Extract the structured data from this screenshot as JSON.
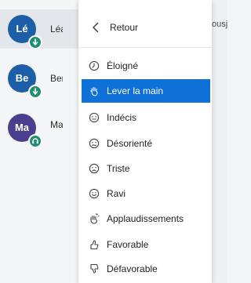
{
  "participants": [
    {
      "initials": "Lé",
      "name": "Léa",
      "avatar_color": "#1d5ea8",
      "status_color": "#1f8f73",
      "status_icon": "arrow-down-icon",
      "active": true
    },
    {
      "initials": "Be",
      "name": "Benj",
      "avatar_color": "#1d5ea8",
      "status_color": "#1f8f73",
      "status_icon": "arrow-down-icon",
      "active": false
    },
    {
      "initials": "Ma",
      "name": "Mari",
      "avatar_color": "#4a3f8f",
      "status_color": "#1f8f73",
      "status_icon": "headset-icon",
      "active": false
    }
  ],
  "background_header_fragment": "ousj",
  "menu": {
    "back_label": "Retour",
    "selected_color": "#0f70d7",
    "items": [
      {
        "label": "Éloigné",
        "icon": "clock-icon",
        "selected": false
      },
      {
        "label": "Lever la main",
        "icon": "raised-hand-icon",
        "selected": true
      },
      {
        "label": "Indécis",
        "icon": "neutral-face-icon",
        "selected": false
      },
      {
        "label": "Désorienté",
        "icon": "confused-face-icon",
        "selected": false
      },
      {
        "label": "Triste",
        "icon": "sad-face-icon",
        "selected": false
      },
      {
        "label": "Ravi",
        "icon": "happy-face-icon",
        "selected": false
      },
      {
        "label": "Applaudissements",
        "icon": "clapping-hands-icon",
        "selected": false
      },
      {
        "label": "Favorable",
        "icon": "thumbs-up-icon",
        "selected": false
      },
      {
        "label": "Défavorable",
        "icon": "thumbs-down-icon",
        "selected": false
      }
    ]
  }
}
